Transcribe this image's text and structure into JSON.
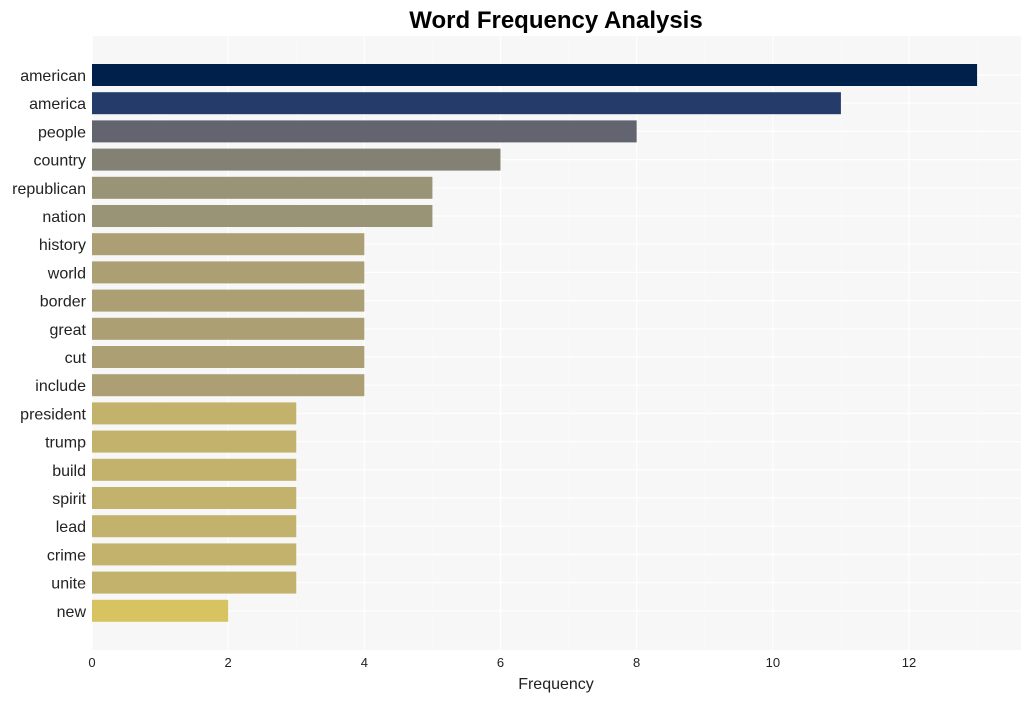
{
  "chart_data": {
    "type": "bar",
    "orientation": "horizontal",
    "title": "Word Frequency Analysis",
    "xlabel": "Frequency",
    "ylabel": "",
    "xlim": [
      0,
      13.7
    ],
    "xticks": [
      0,
      2,
      4,
      6,
      8,
      10,
      12
    ],
    "grid": true,
    "legend": "none",
    "categories": [
      "american",
      "america",
      "people",
      "country",
      "republican",
      "nation",
      "history",
      "world",
      "border",
      "great",
      "cut",
      "include",
      "president",
      "trump",
      "build",
      "spirit",
      "lead",
      "crime",
      "unite",
      "new"
    ],
    "values": [
      13,
      11,
      8,
      6,
      5,
      5,
      4,
      4,
      4,
      4,
      4,
      4,
      3,
      3,
      3,
      3,
      3,
      3,
      3,
      2
    ],
    "colors": [
      "#00204c",
      "#253c6b",
      "#62646f",
      "#838074",
      "#9a9477",
      "#9a9477",
      "#ab9f73",
      "#ab9f73",
      "#ab9f73",
      "#ab9f73",
      "#ab9f73",
      "#ab9f73",
      "#c2b26b",
      "#c2b26b",
      "#c2b26b",
      "#c2b26b",
      "#c2b26b",
      "#c2b26b",
      "#c2b26b",
      "#d7c35f"
    ]
  }
}
